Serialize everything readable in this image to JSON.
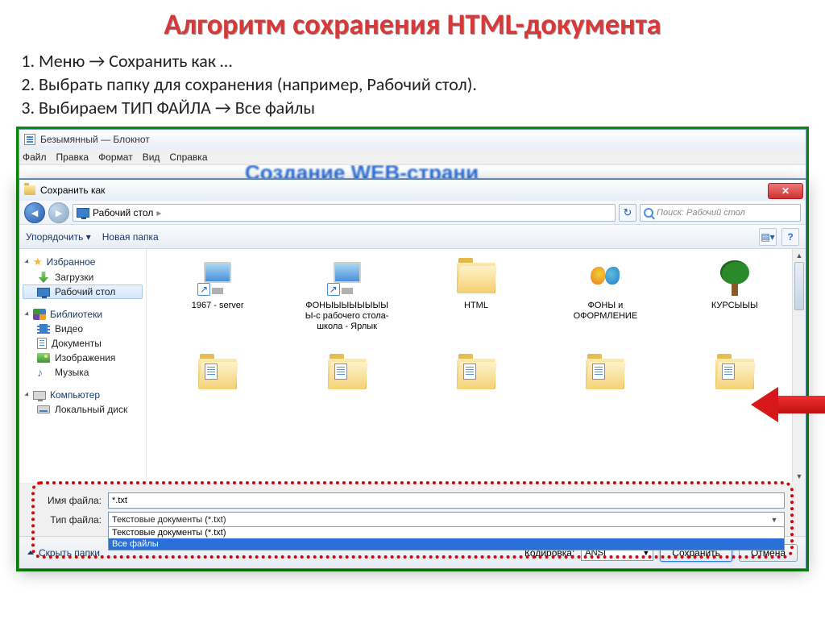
{
  "title": "Алгоритм сохранения HTML-документа",
  "steps": [
    "Меню → Сохранить как …",
    "Выбрать папку для сохранения (например, Рабочий стол).",
    "Выбираем ТИП ФАЙЛА → Все файлы"
  ],
  "notepad": {
    "title": "Безымянный — Блокнот",
    "menu": [
      "Файл",
      "Правка",
      "Формат",
      "Вид",
      "Справка"
    ],
    "bg_hint": "Создание WEB-страни"
  },
  "dialog": {
    "title": "Сохранить как",
    "breadcrumb": "Рабочий стол",
    "breadcrumb_sep": "▸",
    "search_placeholder": "Поиск: Рабочий стол",
    "toolbar": {
      "organize": "Упорядочить ▾",
      "new_folder": "Новая папка"
    },
    "sidebar": {
      "favorites": {
        "head": "Избранное",
        "items": [
          "Загрузки",
          "Рабочий стол"
        ]
      },
      "libraries": {
        "head": "Библиотеки",
        "items": [
          "Видео",
          "Документы",
          "Изображения",
          "Музыка"
        ]
      },
      "computer": {
        "head": "Компьютер",
        "items": [
          "Локальный диск"
        ]
      }
    },
    "files": [
      {
        "name": "1967 - server",
        "type": "pc-shortcut"
      },
      {
        "name": "ФОНЫЫЫЫЫЫЫЫЫ-с рабочего стола-школа - Ярлык",
        "type": "pc-shortcut"
      },
      {
        "name": "HTML",
        "type": "folder"
      },
      {
        "name": "ФОНЫ и ОФОРМЛЕНИЕ",
        "type": "butterfly"
      },
      {
        "name": "КУРСЫЫЫ",
        "type": "tree"
      }
    ],
    "fields": {
      "filename_label": "Имя файла:",
      "filename_value": "*.txt",
      "filetype_label": "Тип файла:",
      "filetype_value": "Текстовые документы (*.txt)",
      "filetype_options": [
        "Текстовые документы (*.txt)",
        "Все файлы"
      ]
    },
    "bottom": {
      "hide_folders": "Скрыть папки",
      "encoding_label": "Кодировка:",
      "encoding_value": "ANSI",
      "save": "Сохранить",
      "cancel": "Отмена"
    }
  }
}
